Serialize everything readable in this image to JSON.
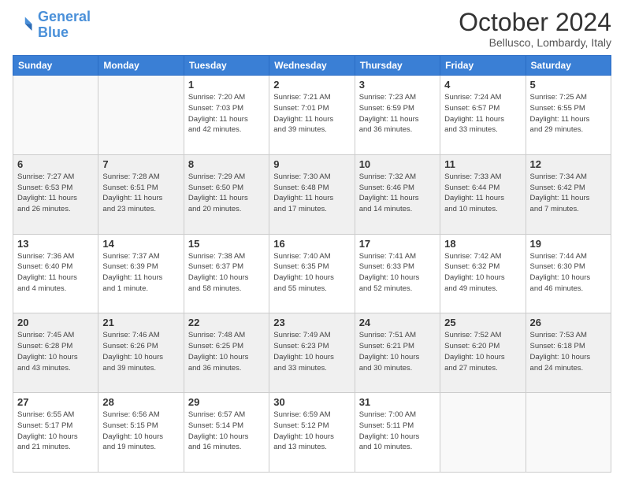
{
  "header": {
    "logo_line1": "General",
    "logo_line2": "Blue",
    "month": "October 2024",
    "location": "Bellusco, Lombardy, Italy"
  },
  "weekdays": [
    "Sunday",
    "Monday",
    "Tuesday",
    "Wednesday",
    "Thursday",
    "Friday",
    "Saturday"
  ],
  "weeks": [
    [
      {
        "day": "",
        "info": ""
      },
      {
        "day": "",
        "info": ""
      },
      {
        "day": "1",
        "info": "Sunrise: 7:20 AM\nSunset: 7:03 PM\nDaylight: 11 hours\nand 42 minutes."
      },
      {
        "day": "2",
        "info": "Sunrise: 7:21 AM\nSunset: 7:01 PM\nDaylight: 11 hours\nand 39 minutes."
      },
      {
        "day": "3",
        "info": "Sunrise: 7:23 AM\nSunset: 6:59 PM\nDaylight: 11 hours\nand 36 minutes."
      },
      {
        "day": "4",
        "info": "Sunrise: 7:24 AM\nSunset: 6:57 PM\nDaylight: 11 hours\nand 33 minutes."
      },
      {
        "day": "5",
        "info": "Sunrise: 7:25 AM\nSunset: 6:55 PM\nDaylight: 11 hours\nand 29 minutes."
      }
    ],
    [
      {
        "day": "6",
        "info": "Sunrise: 7:27 AM\nSunset: 6:53 PM\nDaylight: 11 hours\nand 26 minutes."
      },
      {
        "day": "7",
        "info": "Sunrise: 7:28 AM\nSunset: 6:51 PM\nDaylight: 11 hours\nand 23 minutes."
      },
      {
        "day": "8",
        "info": "Sunrise: 7:29 AM\nSunset: 6:50 PM\nDaylight: 11 hours\nand 20 minutes."
      },
      {
        "day": "9",
        "info": "Sunrise: 7:30 AM\nSunset: 6:48 PM\nDaylight: 11 hours\nand 17 minutes."
      },
      {
        "day": "10",
        "info": "Sunrise: 7:32 AM\nSunset: 6:46 PM\nDaylight: 11 hours\nand 14 minutes."
      },
      {
        "day": "11",
        "info": "Sunrise: 7:33 AM\nSunset: 6:44 PM\nDaylight: 11 hours\nand 10 minutes."
      },
      {
        "day": "12",
        "info": "Sunrise: 7:34 AM\nSunset: 6:42 PM\nDaylight: 11 hours\nand 7 minutes."
      }
    ],
    [
      {
        "day": "13",
        "info": "Sunrise: 7:36 AM\nSunset: 6:40 PM\nDaylight: 11 hours\nand 4 minutes."
      },
      {
        "day": "14",
        "info": "Sunrise: 7:37 AM\nSunset: 6:39 PM\nDaylight: 11 hours\nand 1 minute."
      },
      {
        "day": "15",
        "info": "Sunrise: 7:38 AM\nSunset: 6:37 PM\nDaylight: 10 hours\nand 58 minutes."
      },
      {
        "day": "16",
        "info": "Sunrise: 7:40 AM\nSunset: 6:35 PM\nDaylight: 10 hours\nand 55 minutes."
      },
      {
        "day": "17",
        "info": "Sunrise: 7:41 AM\nSunset: 6:33 PM\nDaylight: 10 hours\nand 52 minutes."
      },
      {
        "day": "18",
        "info": "Sunrise: 7:42 AM\nSunset: 6:32 PM\nDaylight: 10 hours\nand 49 minutes."
      },
      {
        "day": "19",
        "info": "Sunrise: 7:44 AM\nSunset: 6:30 PM\nDaylight: 10 hours\nand 46 minutes."
      }
    ],
    [
      {
        "day": "20",
        "info": "Sunrise: 7:45 AM\nSunset: 6:28 PM\nDaylight: 10 hours\nand 43 minutes."
      },
      {
        "day": "21",
        "info": "Sunrise: 7:46 AM\nSunset: 6:26 PM\nDaylight: 10 hours\nand 39 minutes."
      },
      {
        "day": "22",
        "info": "Sunrise: 7:48 AM\nSunset: 6:25 PM\nDaylight: 10 hours\nand 36 minutes."
      },
      {
        "day": "23",
        "info": "Sunrise: 7:49 AM\nSunset: 6:23 PM\nDaylight: 10 hours\nand 33 minutes."
      },
      {
        "day": "24",
        "info": "Sunrise: 7:51 AM\nSunset: 6:21 PM\nDaylight: 10 hours\nand 30 minutes."
      },
      {
        "day": "25",
        "info": "Sunrise: 7:52 AM\nSunset: 6:20 PM\nDaylight: 10 hours\nand 27 minutes."
      },
      {
        "day": "26",
        "info": "Sunrise: 7:53 AM\nSunset: 6:18 PM\nDaylight: 10 hours\nand 24 minutes."
      }
    ],
    [
      {
        "day": "27",
        "info": "Sunrise: 6:55 AM\nSunset: 5:17 PM\nDaylight: 10 hours\nand 21 minutes."
      },
      {
        "day": "28",
        "info": "Sunrise: 6:56 AM\nSunset: 5:15 PM\nDaylight: 10 hours\nand 19 minutes."
      },
      {
        "day": "29",
        "info": "Sunrise: 6:57 AM\nSunset: 5:14 PM\nDaylight: 10 hours\nand 16 minutes."
      },
      {
        "day": "30",
        "info": "Sunrise: 6:59 AM\nSunset: 5:12 PM\nDaylight: 10 hours\nand 13 minutes."
      },
      {
        "day": "31",
        "info": "Sunrise: 7:00 AM\nSunset: 5:11 PM\nDaylight: 10 hours\nand 10 minutes."
      },
      {
        "day": "",
        "info": ""
      },
      {
        "day": "",
        "info": ""
      }
    ]
  ]
}
